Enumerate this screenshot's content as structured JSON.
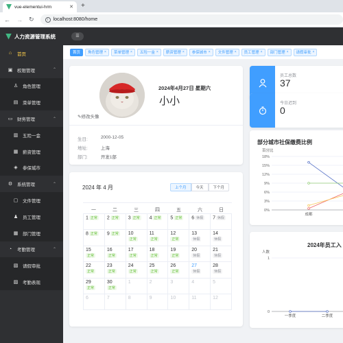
{
  "browser": {
    "tab_title": "vue-elementui-hrm",
    "url": "localhost:8080/home"
  },
  "sidebar": {
    "brand": "人力资源管理系统",
    "items": [
      {
        "label": "首页",
        "icon": "home-icon",
        "type": "top",
        "active": true
      },
      {
        "label": "权限管理",
        "icon": "lock-icon",
        "type": "group"
      },
      {
        "label": "角色管理",
        "icon": "user-icon",
        "type": "sub"
      },
      {
        "label": "菜单管理",
        "icon": "menu-icon",
        "type": "sub"
      },
      {
        "label": "财务管理",
        "icon": "wallet-icon",
        "type": "group"
      },
      {
        "label": "五险一金",
        "icon": "chart-icon",
        "type": "sub"
      },
      {
        "label": "薪资管理",
        "icon": "money-icon",
        "type": "sub"
      },
      {
        "label": "参保城市",
        "icon": "city-icon",
        "type": "sub"
      },
      {
        "label": "系统管理",
        "icon": "gear-icon",
        "type": "group"
      },
      {
        "label": "文件管理",
        "icon": "folder-icon",
        "type": "sub"
      },
      {
        "label": "员工管理",
        "icon": "person-icon",
        "type": "sub"
      },
      {
        "label": "部门管理",
        "icon": "dept-icon",
        "type": "sub"
      },
      {
        "label": "考勤管理",
        "icon": "clock-icon",
        "type": "group"
      },
      {
        "label": "请假审批",
        "icon": "leave-icon",
        "type": "sub"
      },
      {
        "label": "考勤表现",
        "icon": "perf-icon",
        "type": "sub"
      }
    ]
  },
  "tags": [
    "首页",
    "角色管理",
    "菜单管理",
    "五险一金",
    "薪资管理",
    "参保城市",
    "文件管理",
    "员工管理",
    "部门管理",
    "请假审批"
  ],
  "user": {
    "date_line": "2024年4月27日 星期六",
    "name": "小小",
    "edit_avatar": "修改头像",
    "fields": [
      {
        "label": "生日:",
        "value": "2000-12-05"
      },
      {
        "label": "地址:",
        "value": "上海"
      },
      {
        "label": "部门:",
        "value": "开发1部"
      }
    ]
  },
  "stats": [
    {
      "label": "员工总数",
      "value": "37",
      "icon": "person-icon"
    },
    {
      "label": "今日迟到",
      "value": "0",
      "icon": "stopwatch-icon"
    }
  ],
  "calendar": {
    "month_label": "2024 年 4 月",
    "buttons": [
      "上个月",
      "今天",
      "下个月"
    ],
    "weekdays": [
      "一",
      "二",
      "三",
      "四",
      "五",
      "六",
      "日"
    ],
    "days": [
      {
        "d": "1",
        "tag": "正常",
        "k": "n"
      },
      {
        "d": "2",
        "tag": "正常",
        "k": "n"
      },
      {
        "d": "3",
        "tag": "正常",
        "k": "n"
      },
      {
        "d": "4",
        "tag": "正常",
        "k": "n"
      },
      {
        "d": "5",
        "tag": "正常",
        "k": "n"
      },
      {
        "d": "6",
        "tag": "休假",
        "k": "h"
      },
      {
        "d": "7",
        "tag": "休假",
        "k": "h"
      },
      {
        "d": "8",
        "tag": "正常",
        "k": "n"
      },
      {
        "d": "9",
        "tag": "正常",
        "k": "n"
      },
      {
        "d": "10",
        "tag": "正常",
        "k": "n",
        "wrap": true
      },
      {
        "d": "11",
        "tag": "正常",
        "k": "n",
        "wrap": true
      },
      {
        "d": "12",
        "tag": "正常",
        "k": "n",
        "wrap": true
      },
      {
        "d": "13",
        "tag": "休假",
        "k": "h",
        "wrap": true
      },
      {
        "d": "14",
        "tag": "休假",
        "k": "h",
        "wrap": true
      },
      {
        "d": "15",
        "tag": "正常",
        "k": "n",
        "wrap": true
      },
      {
        "d": "16",
        "tag": "正常",
        "k": "n",
        "wrap": true
      },
      {
        "d": "17",
        "tag": "正常",
        "k": "n",
        "wrap": true
      },
      {
        "d": "18",
        "tag": "正常",
        "k": "n",
        "wrap": true
      },
      {
        "d": "19",
        "tag": "正常",
        "k": "n",
        "wrap": true
      },
      {
        "d": "20",
        "tag": "休假",
        "k": "h",
        "wrap": true
      },
      {
        "d": "21",
        "tag": "休假",
        "k": "h",
        "wrap": true
      },
      {
        "d": "22",
        "tag": "正常",
        "k": "n",
        "wrap": true
      },
      {
        "d": "23",
        "tag": "正常",
        "k": "n",
        "wrap": true
      },
      {
        "d": "24",
        "tag": "正常",
        "k": "n",
        "wrap": true
      },
      {
        "d": "25",
        "tag": "正常",
        "k": "n",
        "wrap": true
      },
      {
        "d": "26",
        "tag": "正常",
        "k": "n",
        "wrap": true
      },
      {
        "d": "27",
        "tag": "休假",
        "k": "h",
        "wrap": true,
        "today": true
      },
      {
        "d": "28",
        "tag": "休假",
        "k": "h",
        "wrap": true
      },
      {
        "d": "29",
        "tag": "正常",
        "k": "n",
        "wrap": true
      },
      {
        "d": "30",
        "tag": "正常",
        "k": "n",
        "wrap": true
      },
      {
        "d": "1",
        "other": true
      },
      {
        "d": "2",
        "other": true
      },
      {
        "d": "3",
        "other": true
      },
      {
        "d": "4",
        "other": true
      },
      {
        "d": "5",
        "other": true
      },
      {
        "d": "6",
        "other": true
      },
      {
        "d": "7",
        "other": true
      },
      {
        "d": "8",
        "other": true
      },
      {
        "d": "9",
        "other": true
      },
      {
        "d": "10",
        "other": true
      },
      {
        "d": "11",
        "other": true
      },
      {
        "d": "12",
        "other": true
      }
    ]
  },
  "chart_data": [
    {
      "type": "line",
      "title": "部分城市社保缴费比例",
      "ylabel": "百分比",
      "yticks": [
        "18%",
        "15%",
        "12%",
        "9%",
        "6%",
        "3%",
        "0%"
      ],
      "ylim": [
        0,
        18
      ],
      "categories": [
        "成都"
      ],
      "series": [
        {
          "color": "#5470c6",
          "values": [
            16
          ]
        },
        {
          "color": "#91cc75",
          "values": [
            9
          ]
        },
        {
          "color": "#ee6666",
          "values": [
            0.5
          ]
        },
        {
          "color": "#fac858",
          "values": [
            1.5
          ]
        }
      ]
    },
    {
      "type": "line",
      "title": "2024年员工入",
      "ylabel": "人数",
      "yticks": [
        "1",
        "0"
      ],
      "ylim": [
        0,
        1
      ],
      "categories": [
        "一季度",
        "二季度"
      ],
      "series": [
        {
          "color": "#5470c6",
          "values": [
            0,
            0
          ]
        }
      ]
    }
  ],
  "colors": {
    "primary": "#409eff",
    "sidebar_bg": "#2f3033",
    "active_menu": "#ffd04b"
  }
}
